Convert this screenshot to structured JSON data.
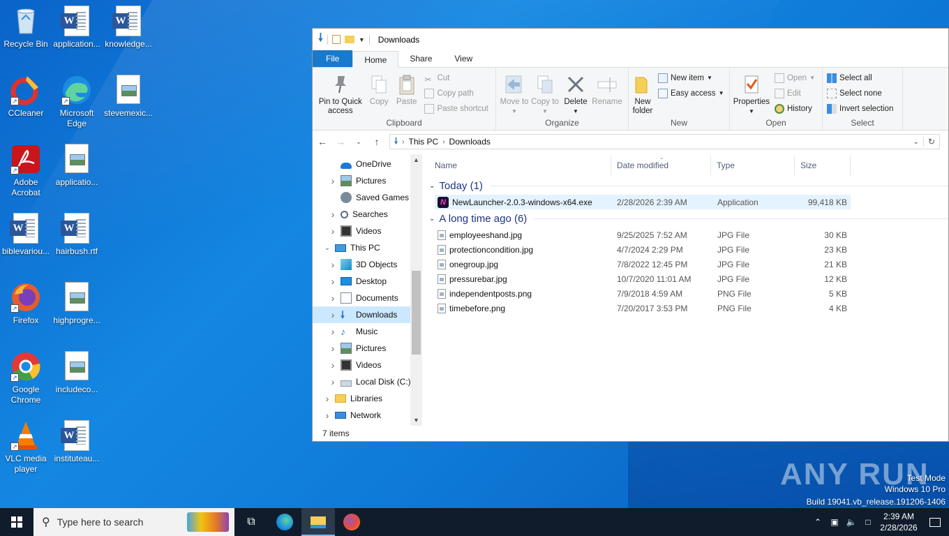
{
  "desktop": {
    "icons": [
      {
        "label": "Recycle Bin",
        "icon": "recycle-bin-icon"
      },
      {
        "label": "application...",
        "icon": "word-doc-icon"
      },
      {
        "label": "knowledge...",
        "icon": "word-doc-icon"
      },
      {
        "label": "CCleaner",
        "icon": "ccleaner-icon"
      },
      {
        "label": "Microsoft Edge",
        "icon": "edge-icon"
      },
      {
        "label": "stevemexic...",
        "icon": "image-file-icon"
      },
      {
        "label": "Adobe Acrobat",
        "icon": "acrobat-icon"
      },
      {
        "label": "applicatio...",
        "icon": "image-file-icon"
      },
      {
        "label": "biblevariou...",
        "icon": "word-doc-icon"
      },
      {
        "label": "hairbush.rtf",
        "icon": "word-doc-icon"
      },
      {
        "label": "Firefox",
        "icon": "firefox-icon"
      },
      {
        "label": "highprogre...",
        "icon": "image-file-icon"
      },
      {
        "label": "Google Chrome",
        "icon": "chrome-icon"
      },
      {
        "label": "includeco...",
        "icon": "image-file-icon"
      },
      {
        "label": "VLC media player",
        "icon": "vlc-icon"
      },
      {
        "label": "instituteau...",
        "icon": "word-doc-icon"
      }
    ]
  },
  "explorer": {
    "title": "Downloads",
    "tabs": [
      "File",
      "Home",
      "Share",
      "View"
    ],
    "ribbon": {
      "clipboard": {
        "name": "Clipboard",
        "pin": "Pin to Quick access",
        "copy": "Copy",
        "paste": "Paste",
        "cut": "Cut",
        "copy_path": "Copy path",
        "paste_shortcut": "Paste shortcut"
      },
      "organize": {
        "name": "Organize",
        "move_to": "Move to",
        "copy_to": "Copy to",
        "delete": "Delete",
        "rename": "Rename"
      },
      "new": {
        "name": "New",
        "new_folder": "New folder",
        "new_item": "New item",
        "easy_access": "Easy access"
      },
      "open": {
        "name": "Open",
        "properties": "Properties",
        "open": "Open",
        "edit": "Edit",
        "history": "History"
      },
      "select": {
        "name": "Select",
        "select_all": "Select all",
        "select_none": "Select none",
        "invert": "Invert selection"
      }
    },
    "address": {
      "parts": [
        "This PC",
        "Downloads"
      ]
    },
    "nav_tree": [
      {
        "label": "OneDrive",
        "icon": "onedrive-icon",
        "indent": 1,
        "arrow": false
      },
      {
        "label": "Pictures",
        "icon": "pictures-folder-icon",
        "indent": 1,
        "arrow": true
      },
      {
        "label": "Saved Games",
        "icon": "saved-games-icon",
        "indent": 1,
        "arrow": false
      },
      {
        "label": "Searches",
        "icon": "searches-icon",
        "indent": 1,
        "arrow": true
      },
      {
        "label": "Videos",
        "icon": "videos-folder-icon",
        "indent": 1,
        "arrow": true
      },
      {
        "label": "This PC",
        "icon": "this-pc-icon",
        "indent": 0,
        "arrow": "open"
      },
      {
        "label": "3D Objects",
        "icon": "3d-objects-icon",
        "indent": 1,
        "arrow": true
      },
      {
        "label": "Desktop",
        "icon": "desktop-folder-icon",
        "indent": 1,
        "arrow": true
      },
      {
        "label": "Documents",
        "icon": "documents-folder-icon",
        "indent": 1,
        "arrow": true
      },
      {
        "label": "Downloads",
        "icon": "downloads-folder-icon",
        "indent": 1,
        "arrow": true,
        "selected": true
      },
      {
        "label": "Music",
        "icon": "music-folder-icon",
        "indent": 1,
        "arrow": true
      },
      {
        "label": "Pictures",
        "icon": "pictures-folder-icon",
        "indent": 1,
        "arrow": true
      },
      {
        "label": "Videos",
        "icon": "videos-folder-icon",
        "indent": 1,
        "arrow": true
      },
      {
        "label": "Local Disk (C:)",
        "icon": "local-disk-icon",
        "indent": 1,
        "arrow": true
      },
      {
        "label": "Libraries",
        "icon": "libraries-icon",
        "indent": 0,
        "arrow": true
      },
      {
        "label": "Network",
        "icon": "network-icon",
        "indent": 0,
        "arrow": true
      }
    ],
    "columns": [
      "Name",
      "Date modified",
      "Type",
      "Size"
    ],
    "groups": [
      {
        "title": "Today (1)",
        "files": [
          {
            "name": "NewLauncher-2.0.3-windows-x64.exe",
            "date": "2/28/2026 2:39 AM",
            "type": "Application",
            "size": "99,418 KB",
            "icon": "exe-app-icon",
            "highlight": true
          }
        ]
      },
      {
        "title": "A long time ago (6)",
        "files": [
          {
            "name": "employeeshand.jpg",
            "date": "9/25/2025 7:52 AM",
            "type": "JPG File",
            "size": "30 KB",
            "icon": "image-file-icon"
          },
          {
            "name": "protectioncondition.jpg",
            "date": "4/7/2024 2:29 PM",
            "type": "JPG File",
            "size": "23 KB",
            "icon": "image-file-icon"
          },
          {
            "name": "onegroup.jpg",
            "date": "7/8/2022 12:45 PM",
            "type": "JPG File",
            "size": "21 KB",
            "icon": "image-file-icon"
          },
          {
            "name": "pressurebar.jpg",
            "date": "10/7/2020 11:01 AM",
            "type": "JPG File",
            "size": "12 KB",
            "icon": "image-file-icon"
          },
          {
            "name": "independentposts.png",
            "date": "7/9/2018 4:59 AM",
            "type": "PNG File",
            "size": "5 KB",
            "icon": "image-file-icon"
          },
          {
            "name": "timebefore.png",
            "date": "7/20/2017 3:53 PM",
            "type": "PNG File",
            "size": "4 KB",
            "icon": "image-file-icon"
          }
        ]
      }
    ],
    "status": "7 items"
  },
  "watermark": {
    "brand": "ANY RUN",
    "mode": "Test Mode",
    "os": "Windows 10 Pro",
    "build": "Build 19041.vb_release.191206-1406"
  },
  "taskbar": {
    "search_placeholder": "Type here to search",
    "time": "2:39 AM",
    "date": "2/28/2026"
  },
  "colors": {
    "accent": "#1979ca",
    "selection": "#cce8ff",
    "taskbar": "#101c2b",
    "group_header": "#1e3287"
  }
}
